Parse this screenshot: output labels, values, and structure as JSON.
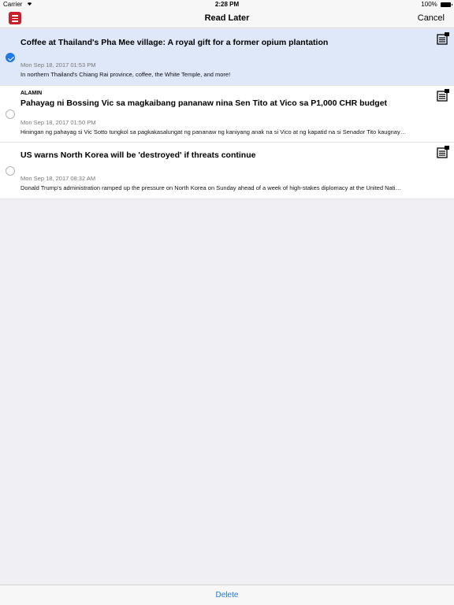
{
  "status": {
    "carrier": "Carrier",
    "time": "2:28 PM",
    "battery": "100%"
  },
  "nav": {
    "title": "Read Later",
    "cancel_label": "Cancel"
  },
  "articles": [
    {
      "source": "",
      "headline": "Coffee at Thailand's Pha Mee village: A royal gift for a former opium plantation",
      "date": "Mon Sep 18, 2017 01:53 PM",
      "summary": "In northern Thailand's Chiang Rai province, coffee, the White Temple, and more!",
      "selected": true
    },
    {
      "source": "ALAMIN",
      "headline": "Pahayag ni Bossing Vic sa magkaibang pananaw nina Sen Tito at Vico sa P1,000 CHR budget",
      "date": "Mon Sep 18, 2017 01:50 PM",
      "summary": "Hiningan ng pahayag si Vic Sotto tungkol sa pagkakasalungat ng pananaw ng kaniyang anak na si Vico at ng kapatid na si Senador Tito kaugnay…",
      "selected": false
    },
    {
      "source": "",
      "headline": "US warns North Korea will be 'destroyed' if threats continue",
      "date": "Mon Sep 18, 2017 08:32 AM",
      "summary": "Donald Trump's administration ramped up the pressure on North Korea on Sunday ahead of a week of high-stakes diplomacy at the United Nati…",
      "selected": false
    }
  ],
  "toolbar": {
    "delete_label": "Delete"
  },
  "colors": {
    "accent": "#1e78e6",
    "brand": "#cc1f2b",
    "selected_row": "#dfe8f8"
  },
  "icons": {
    "menu": "hamburger-menu-icon",
    "article": "article-icon",
    "wifi": "wifi-icon",
    "battery": "battery-icon"
  }
}
